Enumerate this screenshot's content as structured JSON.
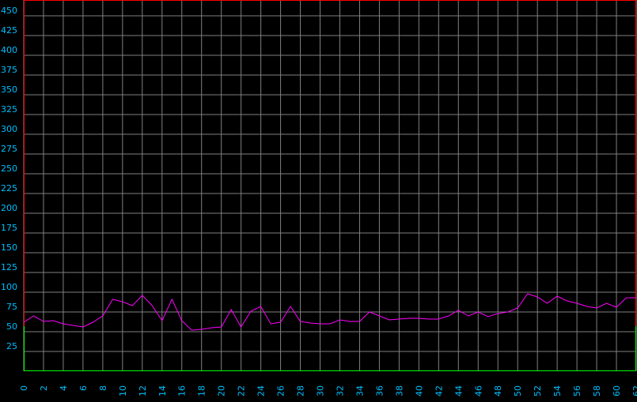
{
  "chart_data": {
    "type": "line",
    "title": "",
    "xlabel": "",
    "ylabel": "",
    "xlim": [
      0,
      62
    ],
    "ylim": [
      0,
      470
    ],
    "grid": true,
    "x_ticks": [
      0,
      2,
      4,
      6,
      8,
      10,
      12,
      14,
      16,
      18,
      20,
      22,
      24,
      26,
      28,
      30,
      32,
      34,
      36,
      38,
      40,
      42,
      44,
      46,
      48,
      50,
      52,
      54,
      56,
      58,
      60,
      62
    ],
    "y_ticks": [
      25,
      50,
      75,
      100,
      125,
      150,
      175,
      200,
      225,
      250,
      275,
      300,
      325,
      350,
      375,
      400,
      425,
      450
    ],
    "threshold_regions": [
      {
        "from": 0,
        "to": 57,
        "color": "#00ff00"
      },
      {
        "from": 57,
        "to": 470,
        "color": "#ff0000"
      }
    ],
    "series": [
      {
        "color": "#ff00ff",
        "x": [
          0,
          1,
          2,
          3,
          4,
          5,
          6,
          7,
          8,
          9,
          10,
          11,
          12,
          13,
          14,
          15,
          16,
          17,
          18,
          19,
          20,
          21,
          22,
          23,
          24,
          25,
          26,
          27,
          28,
          29,
          30,
          31,
          32,
          33,
          34,
          35,
          36,
          37,
          38,
          39,
          40,
          41,
          42,
          43,
          44,
          45,
          46,
          47,
          48,
          49,
          50,
          51,
          52,
          53,
          54,
          55,
          56,
          57,
          58,
          59,
          60,
          61,
          62
        ],
        "y": [
          62,
          70,
          63,
          64,
          60,
          58,
          56,
          62,
          70,
          91,
          88,
          83,
          96,
          83,
          64,
          91,
          64,
          52,
          53,
          55,
          56,
          78,
          56,
          76,
          82,
          60,
          62,
          82,
          63,
          61,
          60,
          60,
          65,
          63,
          63,
          75,
          70,
          65,
          66,
          67,
          67,
          66,
          66,
          70,
          77,
          70,
          75,
          69,
          73,
          75,
          80,
          98,
          94,
          86,
          95,
          89,
          86,
          82,
          80,
          86,
          81,
          93,
          93
        ]
      }
    ]
  },
  "colors": {
    "background": "#000000",
    "grid": "#808080",
    "axis_text": "#00bfff",
    "series": "#ff00ff"
  }
}
